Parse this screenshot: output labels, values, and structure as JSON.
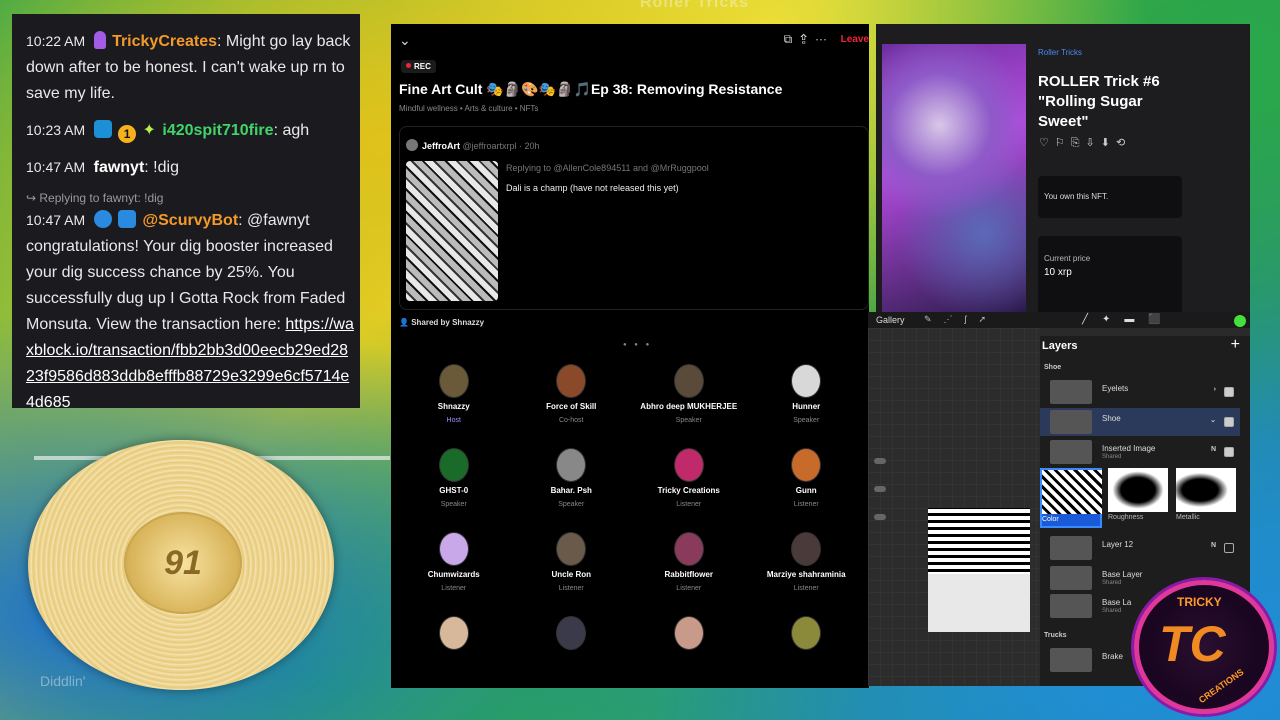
{
  "background_title": "Roller Tricks",
  "chat": {
    "messages": [
      {
        "time": "10:22 AM",
        "user": "TrickyCreates",
        "text": ": Might go lay back down after to be honest. I can't wake up rn to save my life."
      },
      {
        "time": "10:23 AM",
        "user": "i420spit710fire",
        "text": ": agh"
      },
      {
        "time": "10:47 AM",
        "user": "fawnyt",
        "text": ": !dig"
      },
      {
        "reply_hint": "Replying to fawnyt: !dig",
        "time": "10:47 AM",
        "user": "@ScurvyBot",
        "text": ": @fawnyt congratulations! Your dig booster increased your dig success chance by 25%. You successfully dug up I Gotta Rock from Faded Monsuta. View the transaction here: ",
        "link": "https://waxblock.io/transaction/fbb2bb3d00eecb29ed2823f9586d883ddb8efffb88729e3299e6cf5714e4d685"
      }
    ]
  },
  "record": {
    "label": "91"
  },
  "watermark": "Diddlin'",
  "spaces": {
    "leave": "Leave",
    "rec": "REC",
    "title": "Fine Art Cult 🎭🗿🎨🎭🗿🎵Ep 38: Removing Resistance",
    "tags": "Mindful wellness • Arts & culture • NFTs",
    "tweet": {
      "name": "JeffroArt",
      "handle": "@jeffroartxrpl · 20h",
      "replying": "Replying to @AllenCole894511 and @MrRuggpool",
      "text": "Dali is a champ (have not released this yet)"
    },
    "shared_by": "Shared by Shnazzy",
    "participants": [
      {
        "name": "Shnazzy",
        "role": "Host",
        "color": "#6a5a3a"
      },
      {
        "name": "Force of Skill",
        "role": "Co-host",
        "color": "#8a4a2a"
      },
      {
        "name": "Abhro deep MUKHERJEE",
        "role": "Speaker",
        "color": "#5a4a3a"
      },
      {
        "name": "Hunner",
        "role": "Speaker",
        "color": "#d8d8d8"
      },
      {
        "name": "GHST-0",
        "role": "Speaker",
        "color": "#1a6a2a"
      },
      {
        "name": "Bahar. Psh",
        "role": "Speaker",
        "color": "#888888"
      },
      {
        "name": "Tricky Creations",
        "role": "Listener",
        "color": "#c02a6a"
      },
      {
        "name": "Gunn",
        "role": "Listener",
        "color": "#c86a2a"
      },
      {
        "name": "Chumwizards",
        "role": "Listener",
        "color": "#c8a8e8"
      },
      {
        "name": "Uncle Ron",
        "role": "Listener",
        "color": "#6a5a4a"
      },
      {
        "name": "Rabbitflower",
        "role": "Listener",
        "color": "#8a3a5a"
      },
      {
        "name": "Marziye shahraminia",
        "role": "Listener",
        "color": "#4a3a3a"
      },
      {
        "name": "",
        "role": "",
        "color": "#d8b89a"
      },
      {
        "name": "",
        "role": "",
        "color": "#3a3a4a"
      },
      {
        "name": "",
        "role": "",
        "color": "#c89a8a"
      },
      {
        "name": "",
        "role": "",
        "color": "#8a8a3a"
      }
    ]
  },
  "nft": {
    "brand": "Roller Tricks",
    "title": "ROLLER Trick #6 \"Rolling Sugar Sweet\"",
    "owned": "You own this NFT.",
    "price_label": "Current price",
    "price_value": "10 xrp"
  },
  "procreate": {
    "gallery": "Gallery",
    "layers_title": "Layers",
    "group_shoe": "Shoe",
    "group_trucks": "Trucks",
    "layers": [
      {
        "name": "Eyelets",
        "sub": ""
      },
      {
        "name": "Shoe",
        "sub": ""
      },
      {
        "name": "Inserted Image",
        "sub": "Shared",
        "mode": "N"
      },
      {
        "name": "Layer 12",
        "sub": "",
        "mode": "N"
      },
      {
        "name": "Base Layer",
        "sub": "Shared"
      },
      {
        "name": "Base La",
        "sub": "Shared"
      },
      {
        "name": "Brake",
        "sub": ""
      }
    ],
    "textures": [
      "Color",
      "Roughness",
      "Metallic"
    ]
  },
  "logo": {
    "top": "TRICKY",
    "monogram": "TC",
    "bottom": "CREATIONS"
  },
  "colors": {
    "accent_red": "#f0243b",
    "twitter_blue": "#4b8af0",
    "procreate_green": "#44e03c"
  }
}
